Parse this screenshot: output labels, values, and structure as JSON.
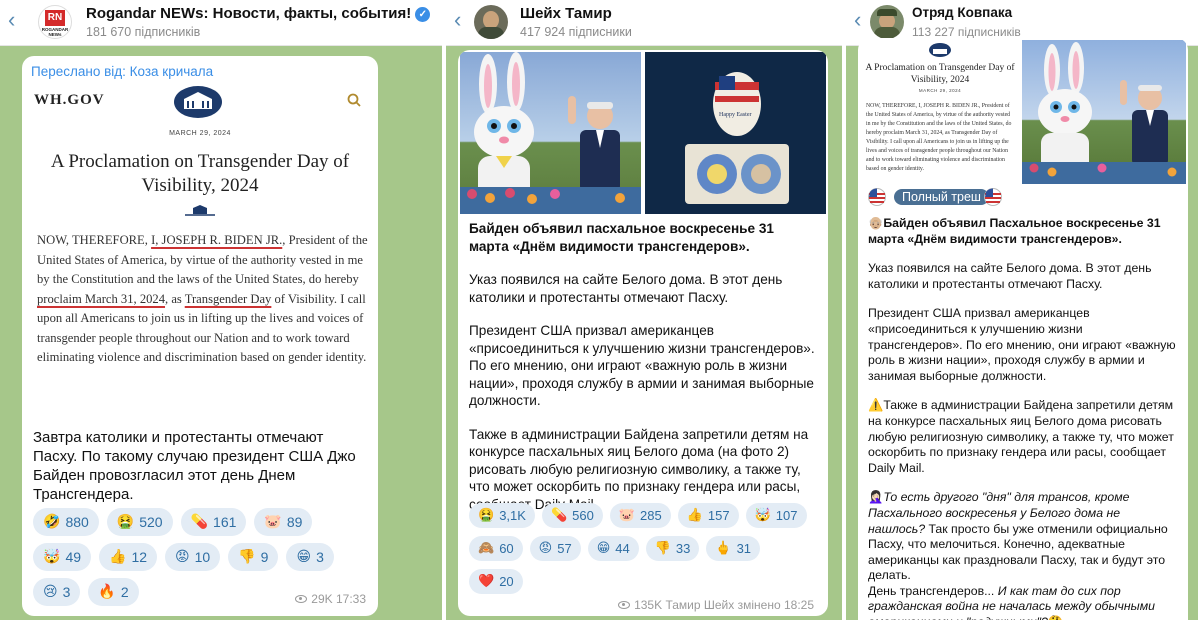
{
  "panels": [
    {
      "channel": "Rogandar NEWs: Новости, факты, события!",
      "subscribers": "181 670 підписників",
      "logo_text": "ROGANDAR NEWs",
      "forwarded": "Переслано від: Коза кричала",
      "doc": {
        "site": "WH.GOV",
        "date": "MARCH 29, 2024",
        "title": "A Proclamation on Transgender Day of Visibility, 2024",
        "body_1": "NOW, THEREFORE, ",
        "body_u1": "I, JOSEPH R. BIDEN JR.",
        "body_2": ", President of the United States of America, by virtue of the authority vested in me by the Constitution and the laws of the United States, do hereby ",
        "body_u2": "proclaim March 31, 2024",
        "body_3": ", as ",
        "body_u3": "Transgender Day",
        "body_4": " of Visibility.  I call upon all Americans to join us in lifting up the lives and voices of transgender people throughout our Nation and to work toward eliminating violence and discrimination based on gender identity."
      },
      "text": "Завтра католики и протестанты отмечают Пасху. По такому случаю президент США Джо Байден провозгласил этот день Днем Трансгендера.",
      "reactions": [
        {
          "emoji": "🤣",
          "count": "880"
        },
        {
          "emoji": "🤮",
          "count": "520"
        },
        {
          "emoji": "💊",
          "count": "161"
        },
        {
          "emoji": "🐷",
          "count": "89"
        },
        {
          "emoji": "🤯",
          "count": "49"
        },
        {
          "emoji": "👍",
          "count": "12"
        },
        {
          "emoji": "😡",
          "count": "10"
        },
        {
          "emoji": "👎",
          "count": "9"
        },
        {
          "emoji": "😁",
          "count": "3"
        },
        {
          "emoji": "😢",
          "count": "3"
        },
        {
          "emoji": "🔥",
          "count": "2"
        }
      ],
      "views": "29K",
      "time": "17:33"
    },
    {
      "channel": "Шейх Тамир",
      "subscribers": "417 924 підписники",
      "photo_egg_text": "Happy Easter",
      "headline": "Байден объявил пасхальное воскресенье 31 марта «Днём видимости трансгендеров».",
      "paragraphs": [
        "Указ появился на сайте Белого дома. В этот день католики и протестанты отмечают Пасху.",
        "Президент США призвал американцев «присоединиться к улучшению жизни трансгендеров». По его мнению, они играют «важную роль в жизни нации», проходя службу в армии и занимая выборные должности.",
        "Также в администрации Байдена запретили детям на конкурсе пасхальных яиц Белого дома (на фото 2) рисовать любую религиозную символику, а также ту, что может оскорбить по признаку гендера или расы, сообщает Daily Mail."
      ],
      "reactions": [
        {
          "emoji": "🤮",
          "count": "3,1K"
        },
        {
          "emoji": "💊",
          "count": "560"
        },
        {
          "emoji": "🐷",
          "count": "285"
        },
        {
          "emoji": "👍",
          "count": "157"
        },
        {
          "emoji": "🤯",
          "count": "107"
        },
        {
          "emoji": "🙈",
          "count": "60"
        },
        {
          "emoji": "😡",
          "count": "57"
        },
        {
          "emoji": "😁",
          "count": "44"
        },
        {
          "emoji": "👎",
          "count": "33"
        },
        {
          "emoji": "🖕",
          "count": "31"
        },
        {
          "emoji": "❤️",
          "count": "20"
        }
      ],
      "views": "135K",
      "signature": "Тамир Шейх",
      "edited": "змінено",
      "time": "18:25"
    },
    {
      "channel": "Отряд Ковпака",
      "subscribers": "113 227 підписників",
      "doc": {
        "title": "A Proclamation on Transgender Day of Visibility, 2024",
        "date": "MARCH 29, 2024",
        "body": "NOW, THEREFORE, I, JOSEPH R. BIDEN JR., President of the United States of America, by virtue of the authority vested in me by the Constitution and the laws of the United States, do hereby proclaim March 31, 2024, as Transgender Day of Visibility.  I call upon all Americans to join us in lifting up the lives and voices of transgender people throughout our Nation and to work toward eliminating violence and discrimination based on gender identity."
      },
      "badge": "Полный треш",
      "headline_emoji": "👴🏼",
      "headline": "Байден объявил Пасхальное воскресенье 31 марта «Днём видимости трансгендеров».",
      "paragraphs": [
        "Указ появился на сайте Белого дома. В этот день католики и протестанты отмечают Пасху.",
        "Президент США призвал американцев «присоединиться к улучшению жизни трансгендеров». По его мнению, они играют «важную роль в жизни нации», проходя службу в армии и занимая выборные должности."
      ],
      "warning_emoji": "⚠️",
      "warning": "Также в администрации Байдена запретили детям на конкурсе пасхальных яиц Белого дома рисовать любую религиозную символику, а также ту, что может оскорбить по признаку гендера или расы, сообщает Daily Mail.",
      "comment_emoji": "🤦🏻‍♀️",
      "comment_italic": "То есть другого \"дня\" для трансов, кроме Пасхального воскресенья у Белого дома не нашлось?",
      "comment_plain": " Так просто бы уже отменили официально Пасху, что мелочиться. Конечно, адекватные американцы как праздновали Пасху, так и будут это делать.",
      "closing_plain": "День трансгендеров...",
      "closing_italic": " И как там до сих пор гражданская война не началась между обычными американцами и \"радужными\"?",
      "closing_emoji": "🤔"
    }
  ],
  "colors": {
    "chat_background": "#a6c78a",
    "link_blue": "#3a8ee6",
    "reaction_bg": "#e3ecf5",
    "underline_red": "#cc3333"
  },
  "icons": [
    "back-arrow-icon",
    "verified-icon",
    "search-icon",
    "eye-icon",
    "us-flag-icon"
  ]
}
